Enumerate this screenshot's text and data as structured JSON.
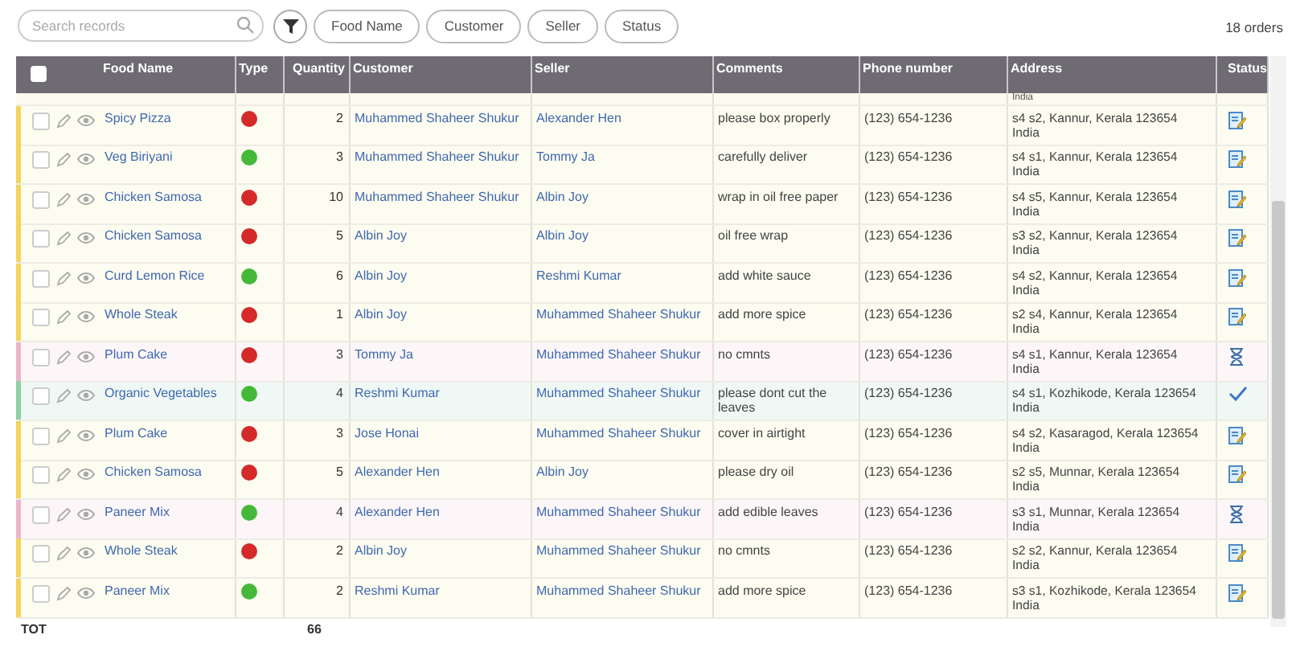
{
  "toolbar": {
    "search": {
      "placeholder": "Search records"
    },
    "filters": [
      "Food Name",
      "Customer",
      "Seller",
      "Status"
    ],
    "count": "18 orders"
  },
  "table": {
    "select_all": {
      "checked": false
    },
    "columns": [
      "Food Name",
      "Type",
      "Quantity",
      "Customer",
      "Seller",
      "Comments",
      "Phone number",
      "Address",
      "Status"
    ],
    "cut_row": {
      "address": "India"
    },
    "rows": [
      {
        "food": "Spicy Pizza",
        "color": "#d42a2a",
        "quantity": "2",
        "customer": "Muhammed Shaheer Shukur",
        "seller": "Alexander Hen",
        "comments": "please box properly",
        "phone": "(123) 654-1236",
        "address": "s4 s2, Kannur, Kerala 123654\nIndia",
        "kind": "pending",
        "checked": false
      },
      {
        "food": "Veg Biriyani",
        "color": "#45b83a",
        "quantity": "3",
        "customer": "Muhammed Shaheer Shukur",
        "seller": "Tommy Ja",
        "comments": "carefully deliver",
        "phone": "(123) 654-1236",
        "address": "s4 s1, Kannur, Kerala 123654\nIndia",
        "kind": "pending",
        "checked": false
      },
      {
        "food": "Chicken Samosa",
        "color": "#d42a2a",
        "quantity": "10",
        "customer": "Muhammed Shaheer Shukur",
        "seller": "Albin Joy",
        "comments": "wrap in oil free paper",
        "phone": "(123) 654-1236",
        "address": "s4 s5, Kannur, Kerala 123654\nIndia",
        "kind": "pending",
        "checked": false
      },
      {
        "food": "Chicken Samosa",
        "color": "#d42a2a",
        "quantity": "5",
        "customer": "Albin Joy",
        "seller": "Albin Joy",
        "comments": "oil free wrap",
        "phone": "(123) 654-1236",
        "address": "s3 s2, Kannur, Kerala 123654\nIndia",
        "kind": "pending",
        "checked": false
      },
      {
        "food": "Curd Lemon Rice",
        "color": "#45b83a",
        "quantity": "6",
        "customer": "Albin Joy",
        "seller": "Reshmi Kumar",
        "comments": "add white sauce",
        "phone": "(123) 654-1236",
        "address": "s4 s2, Kannur, Kerala 123654\nIndia",
        "kind": "pending",
        "checked": false
      },
      {
        "food": "Whole Steak",
        "color": "#d42a2a",
        "quantity": "1",
        "customer": "Albin Joy",
        "seller": "Muhammed Shaheer Shukur",
        "comments": "add more spice",
        "phone": "(123) 654-1236",
        "address": "s2 s4, Kannur, Kerala 123654\nIndia",
        "kind": "pending",
        "checked": false
      },
      {
        "food": "Plum Cake",
        "color": "#d42a2a",
        "quantity": "3",
        "customer": "Tommy Ja",
        "seller": "Muhammed Shaheer Shukur",
        "comments": "no cmnts",
        "phone": "(123) 654-1236",
        "address": "s4 s1, Kannur, Kerala 123654\nIndia",
        "kind": "waiting",
        "checked": false
      },
      {
        "food": "Organic Vegetables",
        "color": "#45b83a",
        "quantity": "4",
        "customer": "Reshmi Kumar",
        "seller": "Muhammed Shaheer Shukur",
        "comments": "please dont cut the leaves",
        "phone": "(123) 654-1236",
        "address": "s4 s1, Kozhikode, Kerala 123654\nIndia",
        "kind": "delivered",
        "checked": false
      },
      {
        "food": "Plum Cake",
        "color": "#d42a2a",
        "quantity": "3",
        "customer": "Jose Honai",
        "seller": "Muhammed Shaheer Shukur",
        "comments": "cover in airtight",
        "phone": "(123) 654-1236",
        "address": "s4 s2, Kasaragod, Kerala 123654\nIndia",
        "kind": "pending",
        "checked": false
      },
      {
        "food": "Chicken Samosa",
        "color": "#d42a2a",
        "quantity": "5",
        "customer": "Alexander Hen",
        "seller": "Albin Joy",
        "comments": "please dry oil",
        "phone": "(123) 654-1236",
        "address": "s2 s5, Munnar, Kerala 123654\nIndia",
        "kind": "pending",
        "checked": false
      },
      {
        "food": "Paneer Mix",
        "color": "#45b83a",
        "quantity": "4",
        "customer": "Alexander Hen",
        "seller": "Muhammed Shaheer Shukur",
        "comments": "add edible leaves",
        "phone": "(123) 654-1236",
        "address": "s3 s1, Munnar, Kerala 123654\nIndia",
        "kind": "waiting",
        "checked": false
      },
      {
        "food": "Whole Steak",
        "color": "#d42a2a",
        "quantity": "2",
        "customer": "Albin Joy",
        "seller": "Muhammed Shaheer Shukur",
        "comments": "no cmnts",
        "phone": "(123) 654-1236",
        "address": "s2 s2, Kannur, Kerala 123654\nIndia",
        "kind": "pending",
        "checked": false
      },
      {
        "food": "Paneer Mix",
        "color": "#45b83a",
        "quantity": "2",
        "customer": "Reshmi Kumar",
        "seller": "Muhammed Shaheer Shukur",
        "comments": "add more spice",
        "phone": "(123) 654-1236",
        "address": "s3 s1, Kozhikode, Kerala 123654\nIndia",
        "kind": "pending",
        "checked": false
      }
    ],
    "footer": {
      "label": "TOT",
      "quantity_total": "66"
    }
  }
}
